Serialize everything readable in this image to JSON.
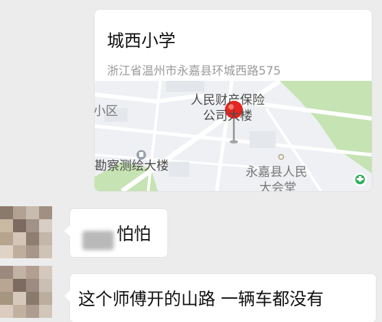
{
  "location_card": {
    "title": "城西小学",
    "address": "浙江省温州市永嘉县环城西路575",
    "map": {
      "labels": {
        "district_fragment": "小区",
        "insurance_line1": "人民财产保险",
        "insurance_line2": "公司大楼",
        "survey_building": "勘察测绘大楼",
        "hall_line1": "永嘉县人民",
        "hall_line2": "大会堂"
      },
      "colors": {
        "pin": "#e5251f",
        "park": "#c6e3b3",
        "road": "#ffffff",
        "map_bg": "#eef0f3"
      }
    }
  },
  "messages": [
    {
      "id": "msg-1",
      "text": "怕怕",
      "has_redacted_prefix": true
    },
    {
      "id": "msg-2",
      "text": "这个师傅开的山路  一辆车都没有"
    }
  ],
  "theme": {
    "chat_bg": "#ececec",
    "bubble_bg": "#ffffff"
  }
}
